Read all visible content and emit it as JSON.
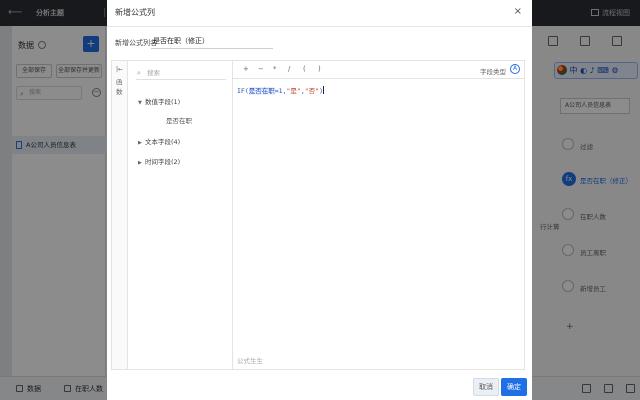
{
  "app": {
    "back_icon": "back-arrow-icon",
    "title": "分析主题",
    "preview_label": "流程视图"
  },
  "left_panel": {
    "heading": "数据",
    "add_label": "+",
    "save_all": "全部保存",
    "save_update_all": "全部保存并更新",
    "search_placeholder": "搜索",
    "item": "A公司人员信息表",
    "bottom_tab_data": "数据",
    "bottom_tab_active": "在职人数"
  },
  "right_panel": {
    "ime_text": "中 ◐ ♪ ⌨ ⚙",
    "steps": [
      "A公司人员信息表",
      "过滤",
      "是否在职（修正）",
      "在职人数",
      "员工离职",
      "新增员工"
    ],
    "card_text": "A公司人员信息表",
    "partial_text": "行计算",
    "add_step": "+"
  },
  "dialog": {
    "title": "新增公式列",
    "close": "×",
    "name_label": "新增公式列名",
    "name_value": "是否在职（修正）",
    "func_toggle": "|←",
    "func_label": "函数",
    "search_placeholder": "搜索",
    "tree": {
      "numeric": "数值字段(1)",
      "numeric_leaf": "是否在职",
      "text": "文本字段(4)",
      "time": "时间字段(2)"
    },
    "operators": [
      "+",
      "−",
      "*",
      "/",
      "(",
      ")"
    ],
    "field_type_label": "字段类型",
    "code": {
      "prefix": "IF(",
      "token": "是否在职",
      "mid": "=1,",
      "str1": "\"是\"",
      "comma": ",",
      "str2": "\"否\"",
      "suffix": ")"
    },
    "tip": "公式生生",
    "cancel": "取消",
    "ok": "确定"
  }
}
